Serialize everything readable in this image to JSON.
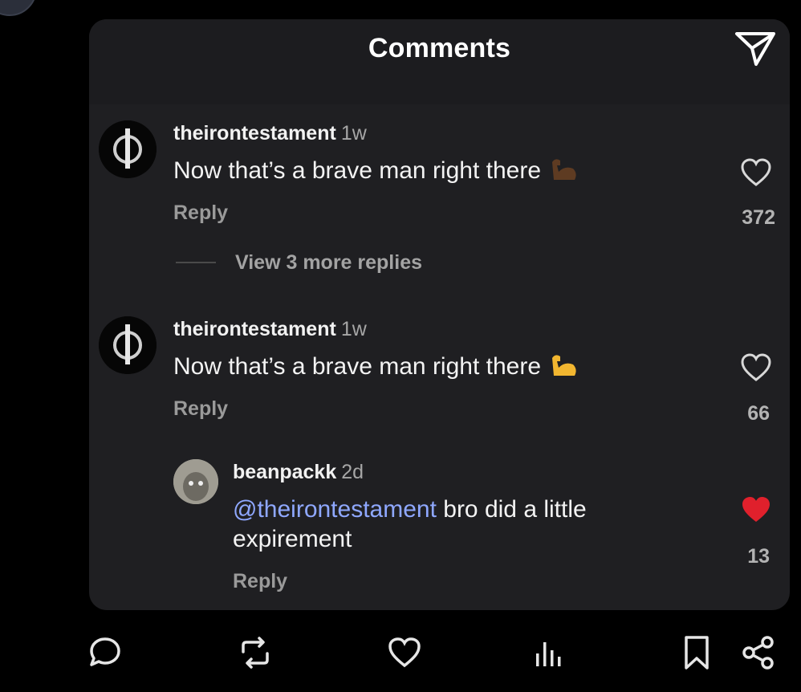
{
  "panel": {
    "title": "Comments",
    "share_icon": "paper-plane-icon"
  },
  "comments": [
    {
      "username": "theirontestament",
      "time": "1w",
      "text": "Now that’s a brave man right there",
      "emoji": "flexed-biceps-dark-skin",
      "reply_label": "Reply",
      "likes": "372",
      "liked": false,
      "view_replies": "View 3 more replies"
    },
    {
      "username": "theirontestament",
      "time": "1w",
      "text": "Now that’s a brave man right there",
      "emoji": "flexed-biceps-yellow",
      "reply_label": "Reply",
      "likes": "66",
      "liked": false
    }
  ],
  "reply": {
    "username": "beanpackk",
    "time": "2d",
    "mention": "@theirontestament",
    "text_line1": " bro did a little",
    "text_line2": "expirement",
    "reply_label": "Reply",
    "likes": "13",
    "liked": true
  },
  "bottom_bar": [
    "comment-icon",
    "repost-icon",
    "heart-icon",
    "views-icon",
    "bookmark-icon",
    "share-icon"
  ],
  "colors": {
    "panel": "#1f1f22",
    "mention": "#8fa8ff",
    "liked_heart": "#e0202c"
  }
}
